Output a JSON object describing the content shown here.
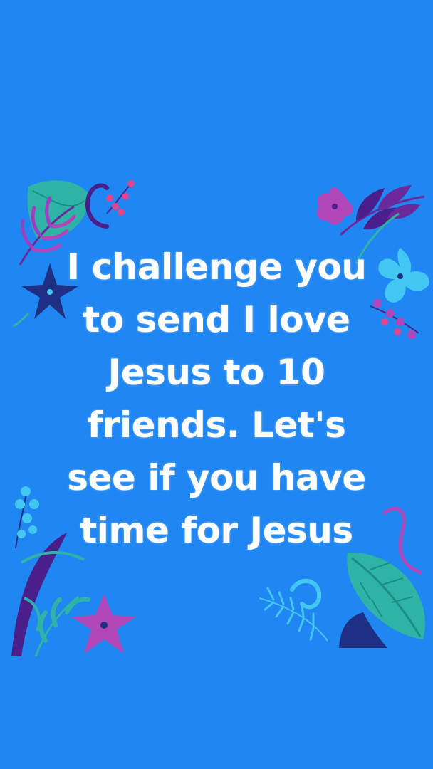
{
  "message": {
    "lines": [
      "I challenge you",
      "to send I love",
      "Jesus to 10",
      "friends. Let's",
      "see if you have",
      "time for Jesus"
    ]
  },
  "colors": {
    "background": "#1f86f2",
    "text": "#ffffff",
    "teal": "#2fb3a6",
    "purple": "#9b3fc4",
    "magenta": "#b046b8",
    "navy": "#1e2f84",
    "indigo": "#4a1f8c",
    "sky": "#42c6f2",
    "pink": "#e2458e"
  },
  "decorations": [
    "teal-leaf-icon",
    "purple-fern-icon",
    "swirl-icon",
    "berry-sprig-icon",
    "magenta-flower-icon",
    "purple-leaves-icon",
    "navy-flower-icon",
    "sky-blue-flower-icon",
    "pink-berries-icon",
    "blue-blossoms-icon",
    "indigo-leaf-icon",
    "magenta-flower-icon",
    "teal-palm-leaf-icon",
    "teal-fern-icon",
    "navy-leaf-icon"
  ]
}
